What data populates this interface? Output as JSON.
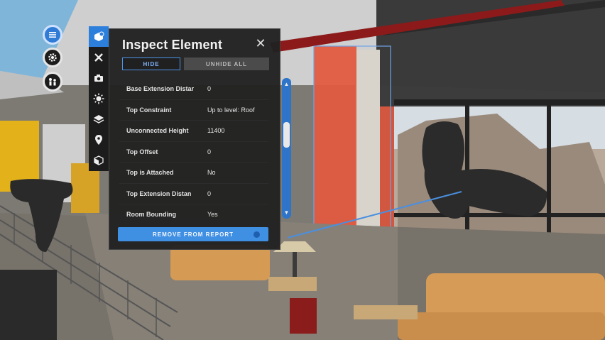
{
  "panel": {
    "title": "Inspect Element",
    "hide_label": "HIDE",
    "unhide_all_label": "UNHIDE ALL",
    "remove_label": "REMOVE FROM REPORT",
    "properties": [
      {
        "key": "Base Extension Distar",
        "value": "0"
      },
      {
        "key": "Top Constraint",
        "value": "Up to level: Roof"
      },
      {
        "key": "Unconnected Height",
        "value": "11400"
      },
      {
        "key": "Top Offset",
        "value": "0"
      },
      {
        "key": "Top is Attached",
        "value": "No"
      },
      {
        "key": "Top Extension Distan",
        "value": "0"
      },
      {
        "key": "Room Bounding",
        "value": "Yes"
      }
    ]
  },
  "menu_icons": [
    "menu-icon",
    "settings-icon",
    "people-icon"
  ],
  "tools": [
    "inspect-cube-icon",
    "ruler-pencil-icon",
    "camera-icon",
    "sun-icon",
    "layers-icon",
    "map-pin-icon",
    "section-cube-icon"
  ],
  "colors": {
    "accent": "#2f7bd6",
    "panel_bg": "#212121",
    "highlight_wall": "#e2573e"
  }
}
